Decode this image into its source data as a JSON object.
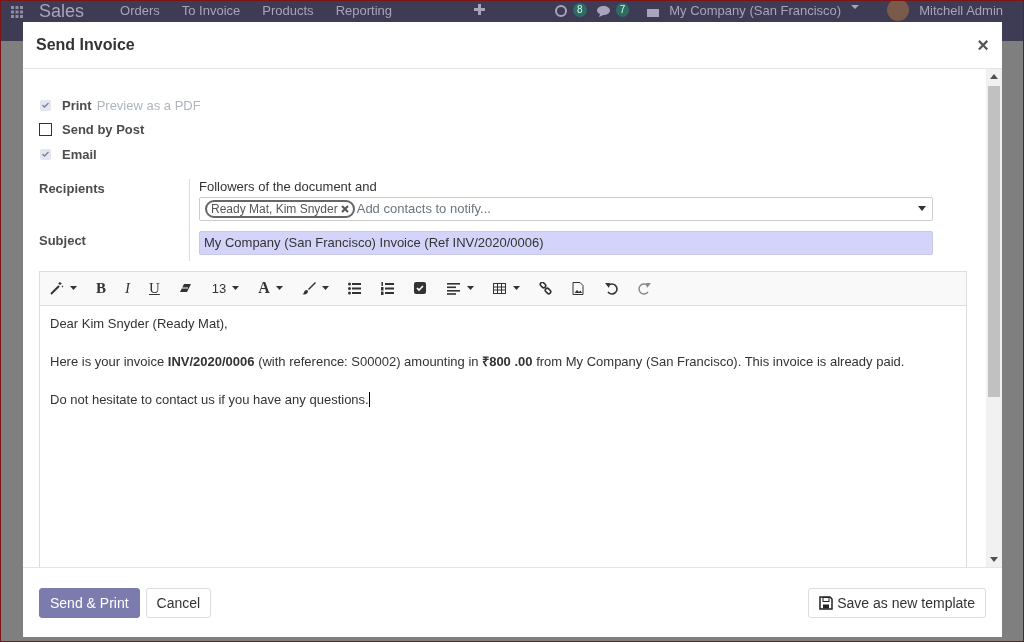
{
  "app_bar": {
    "app_name": "Sales",
    "menu": [
      "Orders",
      "To Invoice",
      "Products",
      "Reporting"
    ],
    "activity_count": "8",
    "message_count": "7",
    "company": "My Company (San Francisco)",
    "user": "Mitchell Admin"
  },
  "dialog": {
    "title": "Send Invoice",
    "close": "×",
    "options": [
      {
        "label": "Print",
        "hint": "Preview as a PDF",
        "checked": true,
        "disabled": true
      },
      {
        "label": "Send by Post",
        "checked": false,
        "disabled": false
      },
      {
        "label": "Email",
        "checked": true,
        "disabled": true
      }
    ],
    "recipients": {
      "label": "Recipients",
      "intro": "Followers of the document and",
      "tags": [
        "Ready Mat, Kim Snyder"
      ],
      "placeholder": "Add contacts to notify..."
    },
    "subject": {
      "label": "Subject",
      "value": "My Company (San Francisco) Invoice (Ref INV/2020/0006)"
    },
    "toolbar": [
      {
        "kind": "magic",
        "caret": true
      },
      {
        "kind": "bold",
        "text": "B"
      },
      {
        "kind": "italic",
        "text": "I"
      },
      {
        "kind": "underline",
        "text": "U"
      },
      {
        "kind": "eraser",
        "caret": false
      },
      {
        "kind": "size",
        "text": "13",
        "caret": true
      },
      {
        "kind": "color",
        "text": "A",
        "caret": true
      },
      {
        "kind": "brush",
        "caret": true
      },
      {
        "kind": "bullets",
        "caret": false
      },
      {
        "kind": "numbers",
        "caret": false
      },
      {
        "kind": "checklist",
        "caret": false
      },
      {
        "kind": "align",
        "caret": true
      },
      {
        "kind": "table",
        "caret": true
      },
      {
        "kind": "link",
        "caret": false
      },
      {
        "kind": "image",
        "caret": false
      },
      {
        "kind": "undo",
        "caret": false
      },
      {
        "kind": "redo",
        "caret": false
      }
    ],
    "body": [
      "Dear Kim Snyder (Ready Mat),",
      "Here is your invoice **INV/2020/0006** (with reference: S00002) amounting in **₹800 .00** from My Company (San Francisco). This invoice is already paid.",
      "Do not hesitate to contact us if you have any questions."
    ],
    "buttons": [
      {
        "label": "Send & Print",
        "kind": "primary"
      },
      {
        "label": "Cancel",
        "kind": "secondary"
      },
      {
        "label": "Save as new template",
        "kind": "template"
      }
    ]
  }
}
